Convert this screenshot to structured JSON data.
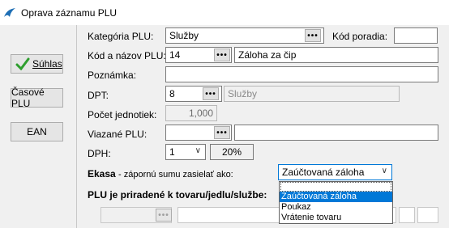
{
  "window": {
    "title": "Oprava záznamu PLU"
  },
  "buttons": {
    "ok_label": "Súhlas",
    "time_label": "Časové PLU",
    "ean_label": "EAN"
  },
  "fields": {
    "kategoria": {
      "label": "Kategória PLU:",
      "value": "Služby"
    },
    "kod_poradia": {
      "label": "Kód poradia:",
      "value": ""
    },
    "kod_nazov": {
      "label": "Kód a názov PLU:",
      "code": "14",
      "name": "Záloha za čip"
    },
    "poznamka": {
      "label": "Poznámka:",
      "value": ""
    },
    "dpt": {
      "label": "DPT:",
      "value": "8",
      "name": "Služby"
    },
    "pocet_jednotiek": {
      "label": "Počet jednotiek:",
      "value": "1,000"
    },
    "viazane_plu": {
      "label": "Viazané PLU:",
      "code": "",
      "name": ""
    },
    "dph": {
      "label": "DPH:",
      "value": "1",
      "rate": "20%"
    }
  },
  "ekasa": {
    "label_bold": "Ekasa",
    "label_rest": "- zápornú sumu zasielať ako:",
    "selected": "Zaúčtovaná záloha",
    "options": [
      "Zaúčtovaná záloha",
      "Poukaz",
      "Vrátenie tovaru"
    ]
  },
  "plu_assigned": {
    "label": "PLU je priradené k tovaru/jedlu/službe:"
  },
  "dots_label": "•••",
  "colors": {
    "accent": "#0078d7",
    "check": "#2e9e2e"
  }
}
